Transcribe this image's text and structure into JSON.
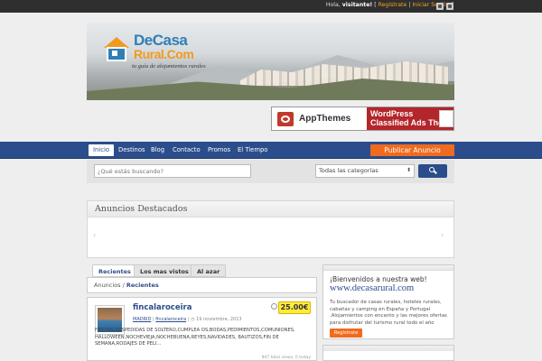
{
  "topbar": {
    "greeting": "Hola, ",
    "user": "visitante!",
    "open_bracket": " [ ",
    "register": "Regístrate",
    "separator": " | ",
    "login": "Iniciar Sesión",
    "close_bracket": " ]"
  },
  "banner": {
    "logo_line1": "DeCasa",
    "logo_line2": "Rural.Com",
    "tagline": "tu guía de alojamientos rurales"
  },
  "ad": {
    "brand": "AppThemes",
    "line1": "WordPress",
    "line2": "Classified Ads Theme"
  },
  "nav": {
    "items": [
      "Inicio",
      "Destinos",
      "Blog",
      "Contacto",
      "Promos",
      "El Tiempo"
    ],
    "active": "Inicio",
    "publish": "Publicar Anuncio"
  },
  "search": {
    "placeholder": "¿Qué estás buscando?",
    "category": "Todas las categorías"
  },
  "featured": {
    "title": "Anuncios Destacados",
    "prev": "‹",
    "next": "›"
  },
  "tabs": [
    "Recientes",
    "Los mas vistos",
    "Al azar"
  ],
  "breadcrumb": {
    "root": "Anuncios",
    "sep": " / ",
    "current": "Recientes"
  },
  "listing": {
    "title": "fincalaroceira",
    "price": "25.00€",
    "category": "MADRID",
    "author": "fincalaroceira",
    "date": "19 noviembre, 2013",
    "description": "FIESTAS,DESPEDIDAS DE SOLTERO,CUMPLEA OS,BODAS,PEDIMIENTOS,COMUNIONES, HALLOWEEN,NOCHEVIEJA,NOCHEBUENA,REYES,NAVIDADES, BAUTIZOS,FIN DE SEMANA,RODAJES DE PELI...",
    "views": "947 total views, 0 today"
  },
  "welcome": {
    "heading": "¡Bienvenidos a nuestra web!",
    "site": "www.decasarural.com",
    "text": "Tu buscador de casas rurales, hoteles rurales, cabañas y camping en España y Portugal .Alojamientos con encanto y las mejores ofertas para disfrutar del turismo rural todo el año",
    "register": "Regístrate"
  }
}
